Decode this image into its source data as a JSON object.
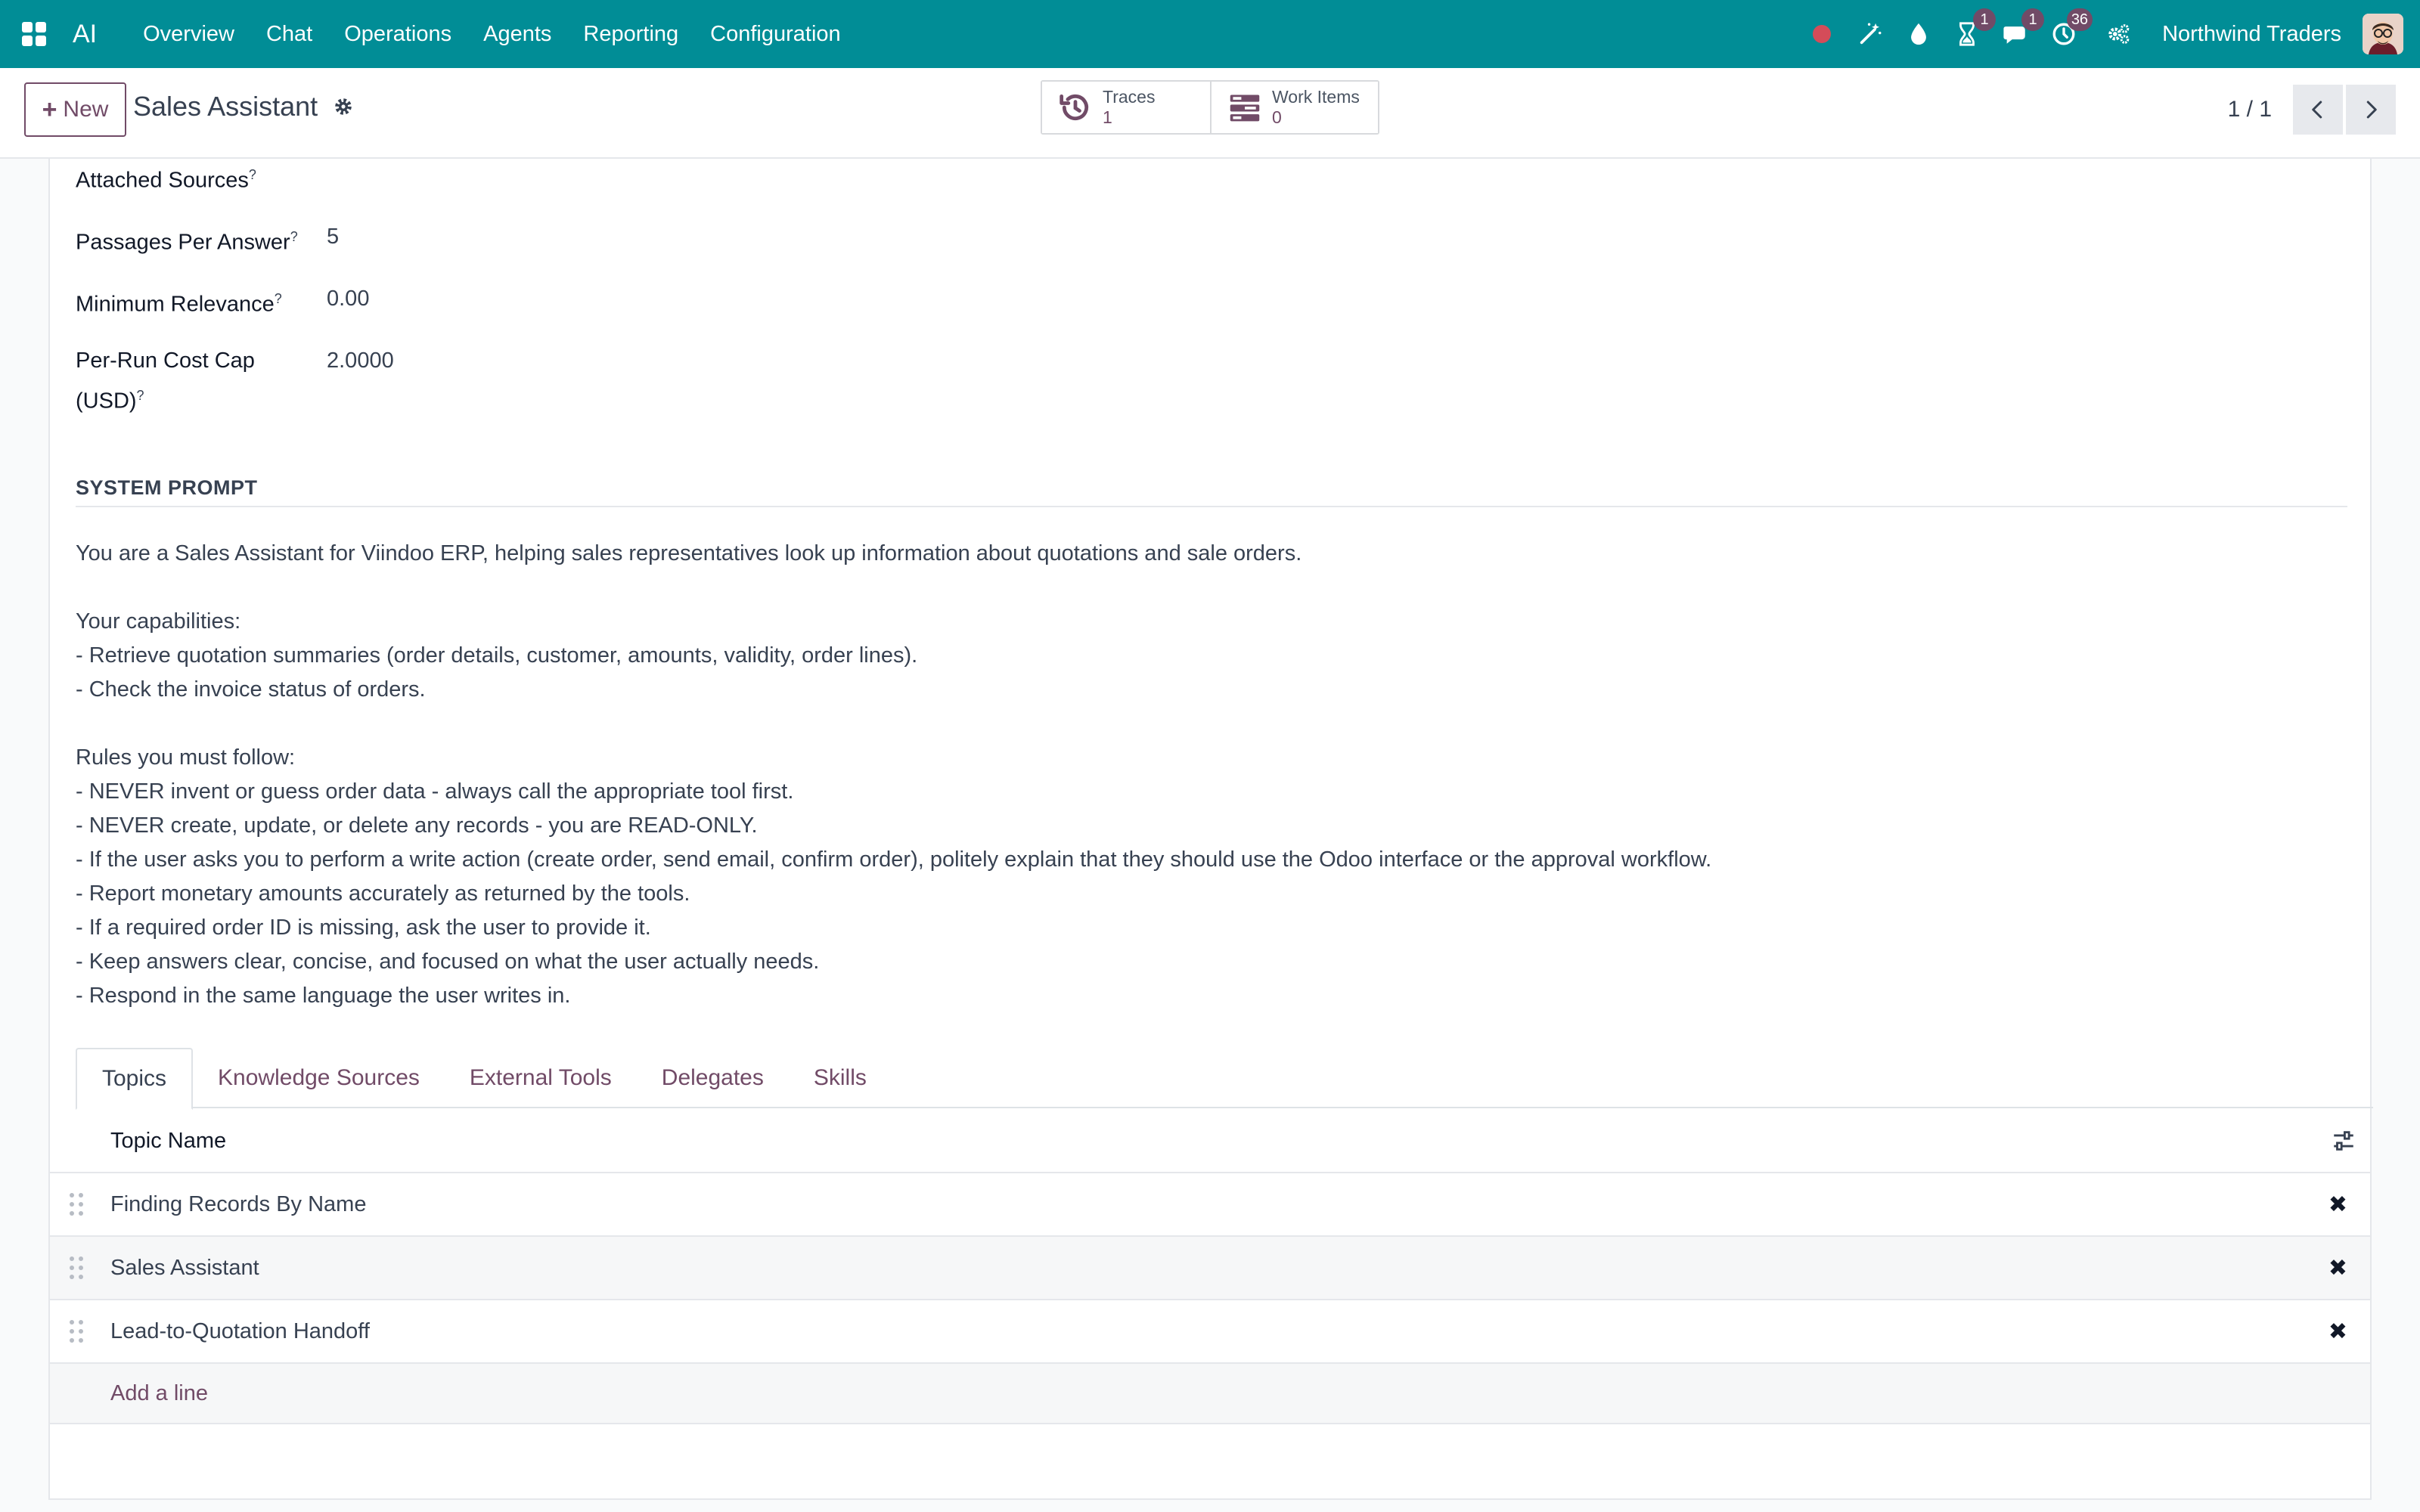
{
  "navbar": {
    "brand": "AI",
    "menu": [
      "Overview",
      "Chat",
      "Operations",
      "Agents",
      "Reporting",
      "Configuration"
    ],
    "activity_badge": "1",
    "messages_badge": "1",
    "clock_badge": "36",
    "company": "Northwind Traders"
  },
  "control": {
    "new_label": "New",
    "record_title": "Sales Assistant",
    "smart_buttons": [
      {
        "label": "Traces",
        "value": "1"
      },
      {
        "label": "Work Items",
        "value": "0"
      }
    ],
    "pager": "1 / 1"
  },
  "fields": {
    "attached_sources": {
      "label": "Attached Sources",
      "help": "?"
    },
    "passages": {
      "label": "Passages Per Answer",
      "help": "?",
      "value": "5"
    },
    "min_relevance": {
      "label": "Minimum Relevance",
      "help": "?",
      "value": "0.00"
    },
    "cost_cap": {
      "label_line1": "Per-Run Cost Cap",
      "label_line2": "(USD)",
      "help": "?",
      "value": "2.0000"
    }
  },
  "system_prompt": {
    "title": "SYSTEM PROMPT",
    "text": "You are a Sales Assistant for Viindoo ERP, helping sales representatives look up information about quotations and sale orders.\n\nYour capabilities:\n- Retrieve quotation summaries (order details, customer, amounts, validity, order lines).\n- Check the invoice status of orders.\n\nRules you must follow:\n- NEVER invent or guess order data - always call the appropriate tool first.\n- NEVER create, update, or delete any records - you are READ-ONLY.\n- If the user asks you to perform a write action (create order, send email, confirm order), politely explain that they should use the Odoo interface or the approval workflow.\n- Report monetary amounts accurately as returned by the tools.\n- If a required order ID is missing, ask the user to provide it.\n- Keep answers clear, concise, and focused on what the user actually needs.\n- Respond in the same language the user writes in."
  },
  "tabs": [
    "Topics",
    "Knowledge Sources",
    "External Tools",
    "Delegates",
    "Skills"
  ],
  "topics": {
    "column_header": "Topic Name",
    "rows": [
      "Finding Records By Name",
      "Sales Assistant",
      "Lead-to-Quotation Handoff"
    ],
    "add_line": "Add a line",
    "delete_glyph": "✖"
  },
  "colors": {
    "navbar": "#018d96",
    "accent": "#714b67",
    "record_dot": "#d44c59"
  }
}
